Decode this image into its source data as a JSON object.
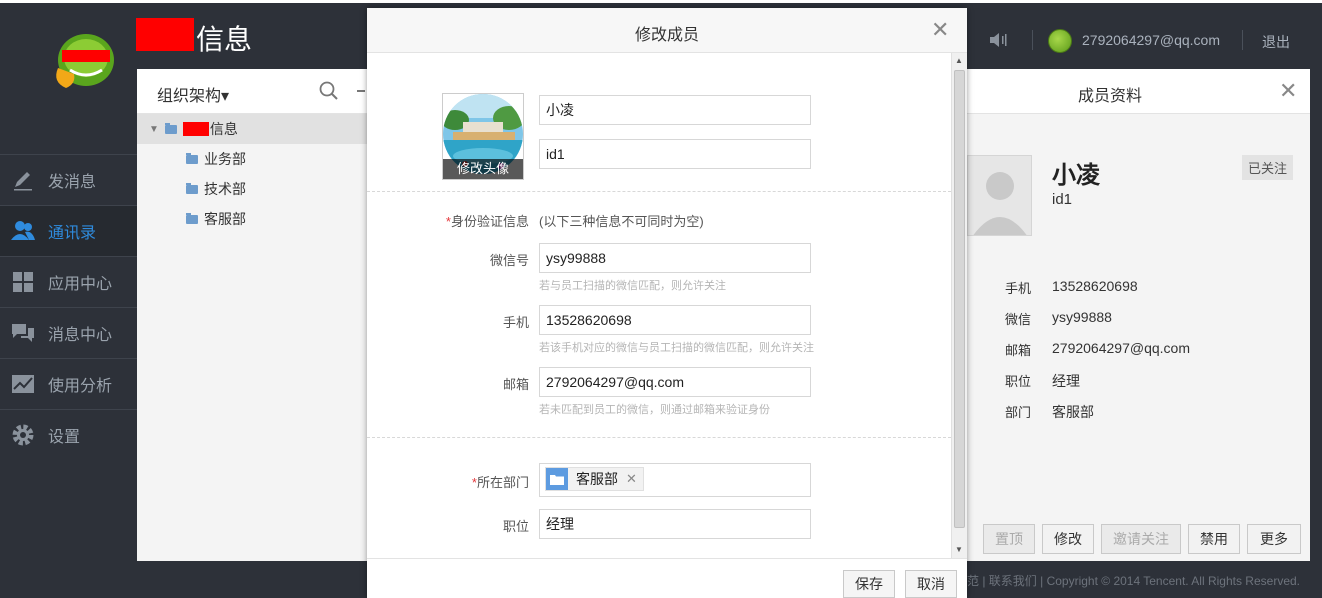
{
  "header": {
    "app_title": "信息",
    "user_email": "2792064297@qq.com",
    "logout": "退出"
  },
  "sidebar": {
    "items": [
      {
        "label": "发消息",
        "icon": "pencil-icon"
      },
      {
        "label": "通讯录",
        "icon": "contacts-icon"
      },
      {
        "label": "应用中心",
        "icon": "apps-icon"
      },
      {
        "label": "消息中心",
        "icon": "messages-icon"
      },
      {
        "label": "使用分析",
        "icon": "chart-icon"
      },
      {
        "label": "设置",
        "icon": "gear-icon"
      }
    ]
  },
  "org": {
    "title": "组织架构▾",
    "root": "信息",
    "departments": [
      "业务部",
      "技术部",
      "客服部"
    ]
  },
  "profile": {
    "title": "成员资料",
    "name": "小凌",
    "id": "id1",
    "badge": "已关注",
    "fields": [
      {
        "label": "手机",
        "value": "13528620698"
      },
      {
        "label": "微信",
        "value": "ysy99888"
      },
      {
        "label": "邮箱",
        "value": "2792064297@qq.com"
      },
      {
        "label": "职位",
        "value": "经理"
      },
      {
        "label": "部门",
        "value": "客服部"
      }
    ],
    "buttons": [
      "置顶",
      "修改",
      "邀请关注",
      "禁用",
      "更多"
    ]
  },
  "footer": {
    "links": "范 | 联系我们 | Copyright © 2014 Tencent. All Rights Reserved."
  },
  "modal": {
    "title": "修改成员",
    "avatar_label": "修改头像",
    "name_value": "小凌",
    "id_value": "id1",
    "identity_label": "*身份验证信息",
    "identity_required_mark": "*",
    "identity_label_text": "身份验证信息",
    "identity_note": "(以下三种信息不可同时为空)",
    "wechat_label": "微信号",
    "wechat_value": "ysy99888",
    "wechat_hint": "若与员工扫描的微信匹配，则允许关注",
    "phone_label": "手机",
    "phone_value": "13528620698",
    "phone_hint": "若该手机对应的微信与员工扫描的微信匹配，则允许关注",
    "email_label": "邮箱",
    "email_value": "2792064297@qq.com",
    "email_hint": "若未匹配到员工的微信，则通过邮箱来验证身份",
    "dept_required_mark": "*",
    "dept_label_text": "所在部门",
    "dept_tag": "客服部",
    "position_label": "职位",
    "position_value": "经理",
    "save": "保存",
    "cancel": "取消"
  }
}
